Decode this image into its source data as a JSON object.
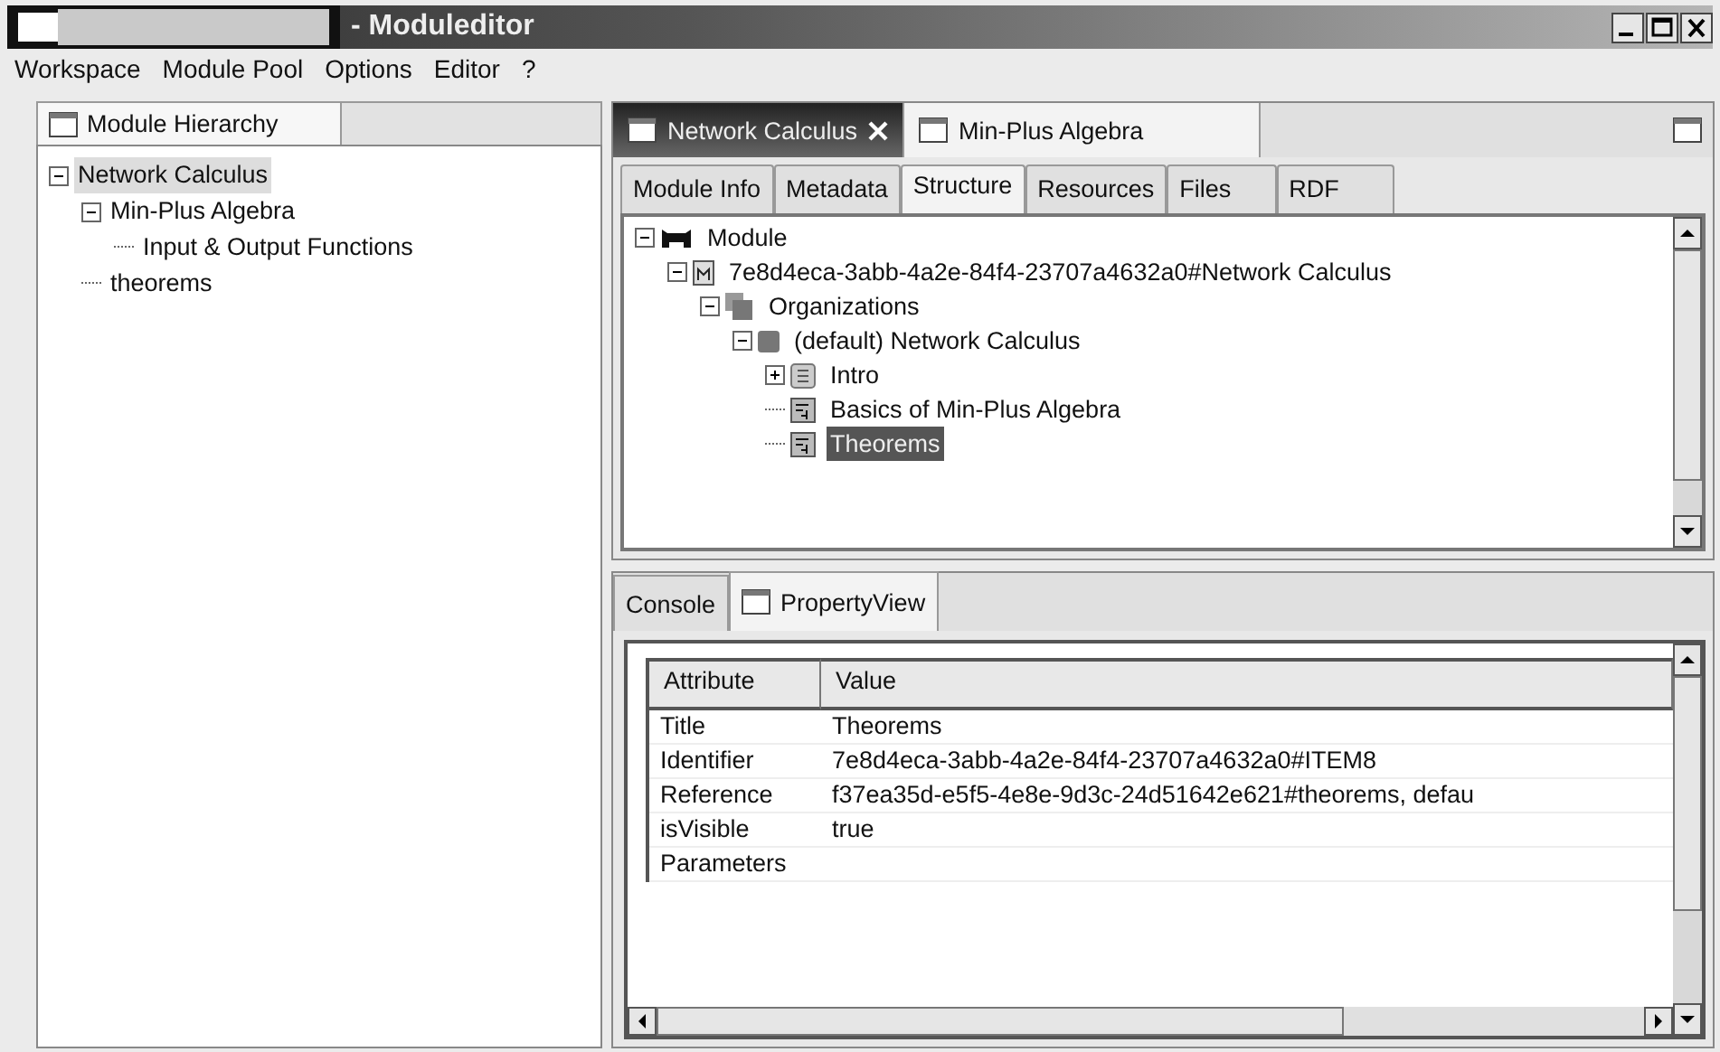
{
  "window": {
    "title": "- Moduleditor"
  },
  "menu": [
    "Workspace",
    "Module Pool",
    "Options",
    "Editor",
    "?"
  ],
  "hierarchy": {
    "tab": "Module Hierarchy",
    "items": [
      {
        "label": "Network Calculus",
        "selected": true,
        "expanded": true,
        "children": [
          {
            "label": "Min-Plus Algebra",
            "selected": false,
            "expanded": true,
            "children": [
              {
                "label": "Input & Output Functions",
                "selected": false
              }
            ]
          },
          {
            "label": "theorems",
            "selected": false
          }
        ]
      }
    ]
  },
  "editor_tabs": [
    {
      "label": "Network Calculus",
      "selected": true
    },
    {
      "label": "Min-Plus Algebra",
      "selected": false
    }
  ],
  "sub_tabs": [
    {
      "label": "Module Info",
      "selected": false
    },
    {
      "label": "Metadata",
      "selected": false
    },
    {
      "label": "Structure",
      "selected": true
    },
    {
      "label": "Resources",
      "selected": false
    },
    {
      "label": "Files",
      "selected": false
    },
    {
      "label": "RDF",
      "selected": false
    }
  ],
  "structure": [
    {
      "kind": "module",
      "label": "Module",
      "selected": false,
      "expanded": true,
      "children": [
        {
          "kind": "manifest",
          "label": "7e8d4eca-3abb-4a2e-84f4-23707a4632a0#Network Calculus",
          "selected": false,
          "expanded": true,
          "children": [
            {
              "kind": "organizations",
              "label": "Organizations",
              "selected": false,
              "expanded": true,
              "children": [
                {
                  "kind": "organization",
                  "label": "(default) Network Calculus",
                  "selected": false,
                  "expanded": true,
                  "children": [
                    {
                      "kind": "item",
                      "label": "Intro",
                      "selected": false,
                      "expanded": false
                    },
                    {
                      "kind": "page",
                      "label": "Basics of Min-Plus Algebra",
                      "selected": false
                    },
                    {
                      "kind": "page",
                      "label": "Theorems",
                      "selected": true
                    }
                  ]
                }
              ]
            }
          ]
        }
      ]
    }
  ],
  "bottom_tabs": [
    {
      "label": "Console",
      "selected": false
    },
    {
      "label": "PropertyView",
      "selected": true
    }
  ],
  "properties": {
    "columns": [
      "Attribute",
      "Value"
    ],
    "rows": [
      [
        "Title",
        "Theorems"
      ],
      [
        "Identifier",
        "7e8d4eca-3abb-4a2e-84f4-23707a4632a0#ITEM8"
      ],
      [
        "Reference",
        "f37ea35d-e5f5-4e8e-9d3c-24d51642e621#theorems, defau"
      ],
      [
        "isVisible",
        "true"
      ],
      [
        "Parameters",
        ""
      ]
    ]
  }
}
